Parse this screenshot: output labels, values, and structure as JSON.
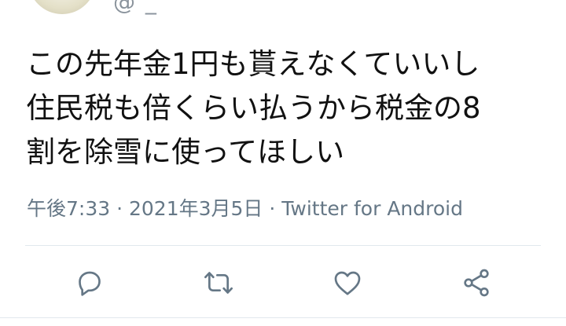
{
  "user": {
    "handle_fragment": "@ _"
  },
  "tweet": {
    "lines": [
      "この先年金1円も貰えなくていいし",
      "住民税も倍くらい払うから税金の8",
      "割を除雪に使ってほしい"
    ],
    "meta": "午後7:33 · 2021年3月5日 · Twitter for Android"
  },
  "icons": {
    "reply": "reply-icon",
    "retweet": "retweet-icon",
    "like": "like-icon",
    "share": "share-icon"
  },
  "colors": {
    "text": "#111111",
    "muted": "#657786",
    "icon": "#657786",
    "divider": "#e1e8ed"
  }
}
